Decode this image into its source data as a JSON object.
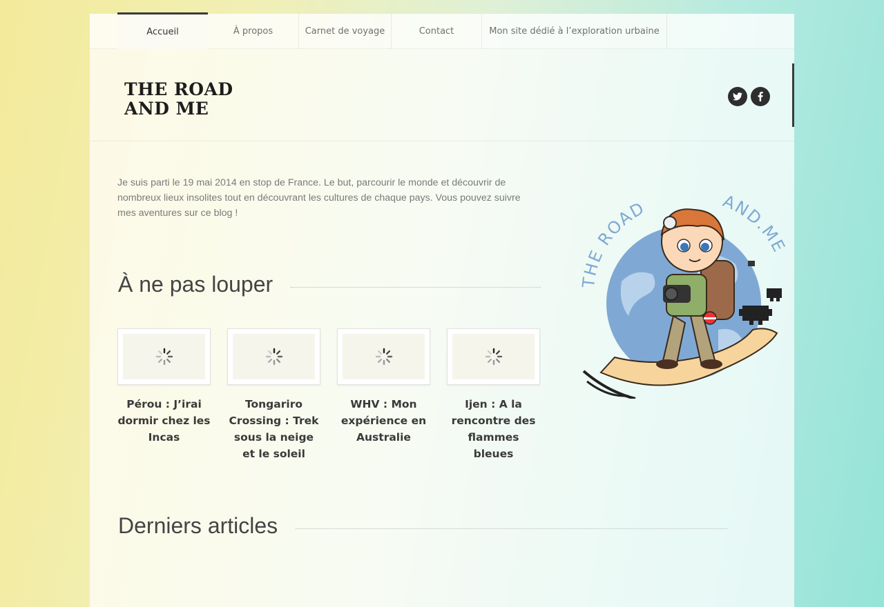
{
  "nav": {
    "items": [
      {
        "label": "Accueil",
        "active": true
      },
      {
        "label": "À propos"
      },
      {
        "label": "Carnet de voyage"
      },
      {
        "label": "Contact"
      },
      {
        "label": "Mon site dédié à l’exploration urbaine"
      }
    ]
  },
  "header": {
    "logo_line1": "THE ROAD",
    "logo_line2": "AND ME",
    "social": [
      {
        "icon": "twitter-icon"
      },
      {
        "icon": "facebook-icon"
      }
    ]
  },
  "intro": {
    "text": "Je suis parti le 19 mai 2014 en stop de France. Le but, parcourir le monde et découvrir de nombreux lieux insolites tout en découvrant les cultures de chaque pays. Vous pouvez suivre mes aventures sur ce blog !"
  },
  "featured": {
    "title": "À ne pas louper",
    "cards": [
      {
        "title": "Pérou : J’irai dormir chez les Incas"
      },
      {
        "title": "Tongariro Crossing : Trek sous la neige et le soleil"
      },
      {
        "title": "WHV : Mon expérience en Australie"
      },
      {
        "title": "Ijen : A la rencontre des flammes bleues"
      }
    ]
  },
  "latest": {
    "title": "Derniers articles"
  },
  "mascot": {
    "arc_left": "THE ROAD",
    "arc_right": "AND.ME"
  },
  "colors": {
    "globe": "#7fa9d4",
    "road": "#f6d49c",
    "nav_active_border": "#3a3a3a"
  }
}
